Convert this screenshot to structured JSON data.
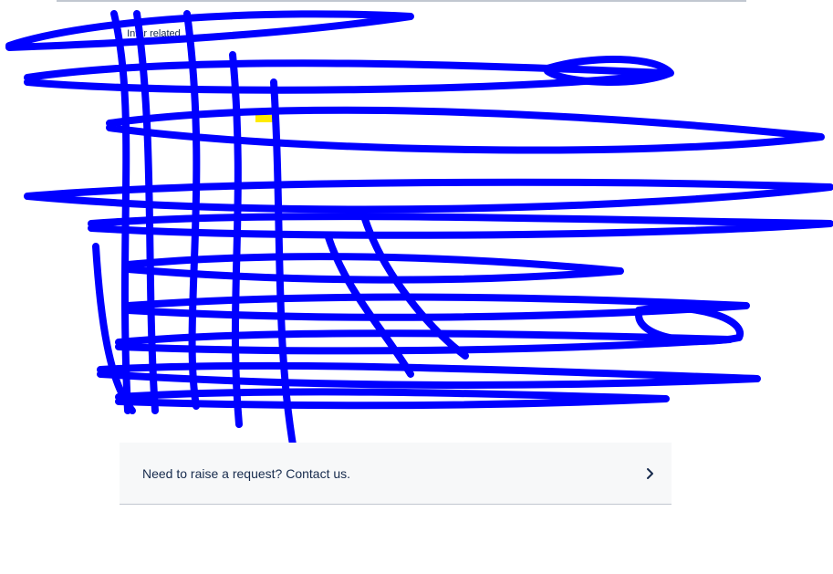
{
  "breadcrumb": {
    "items": [
      "Intor related"
    ],
    "separator": "/"
  },
  "contact": {
    "label": "Need to raise a request? Contact us.",
    "icon": "chevron-right-icon"
  },
  "colors": {
    "scribble": "#0000ff",
    "highlight": "#ffeb00",
    "card_background": "#f7f8f9",
    "text": "#172b4d"
  }
}
